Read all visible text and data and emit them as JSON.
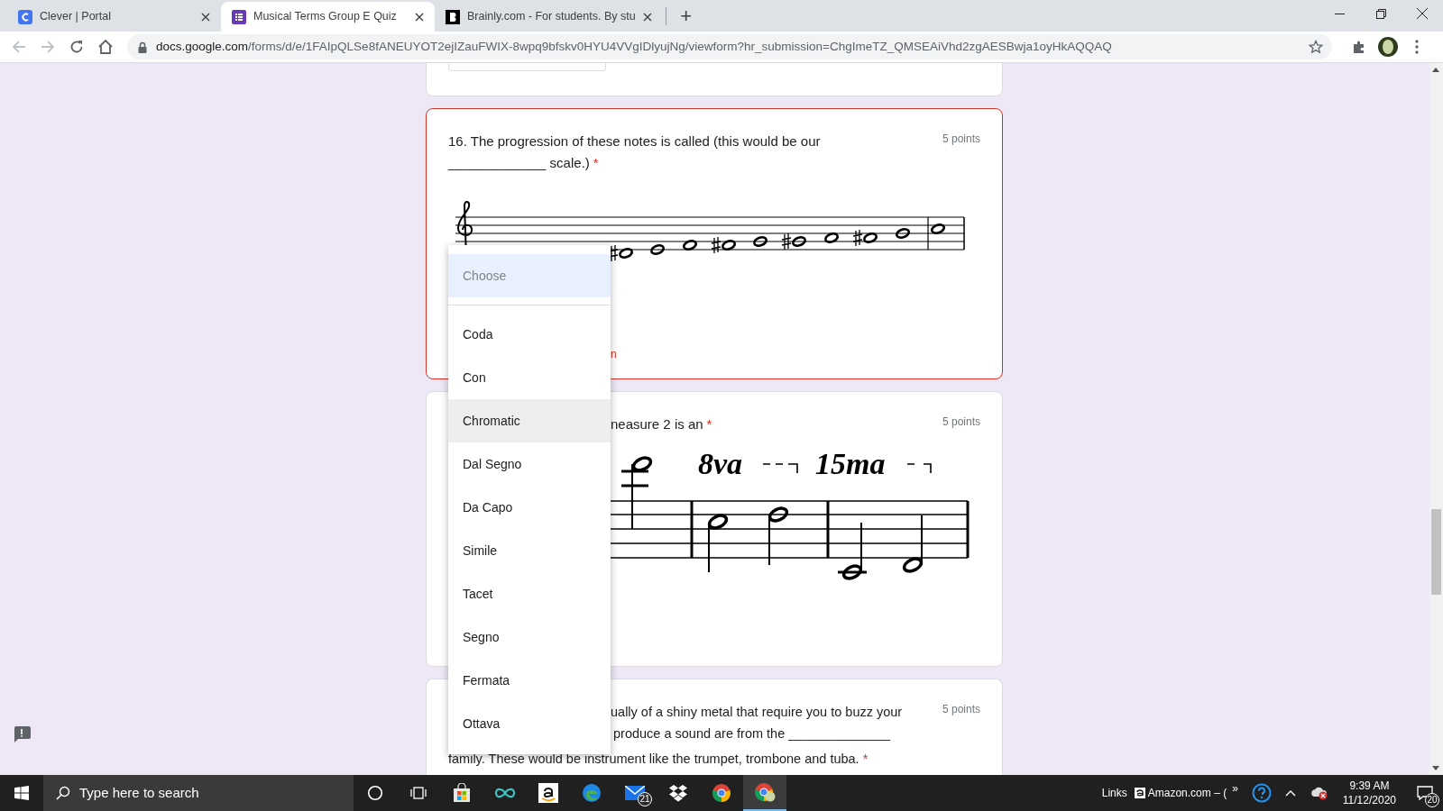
{
  "browser": {
    "tabs": [
      {
        "title": "Clever | Portal",
        "selected": false,
        "kind": "clever"
      },
      {
        "title": "Musical Terms Group E Quiz",
        "selected": true,
        "kind": "forms"
      },
      {
        "title": "Brainly.com - For students. By stu",
        "selected": false,
        "kind": "brainly"
      }
    ],
    "new_tab": "+",
    "url_host": "docs.google.com",
    "url_path": "/forms/d/e/1FAIpQLSe8fANEUYOT2ejIZauFWIX-8wpq9bfskv0HYU4VVgIDlyujNg/viewform?hr_submission=ChgImeTZ_QMSEAiVhd2zgAESBwja1oyHkAQQAQ"
  },
  "questions": [
    {
      "kind": "scale",
      "invalid": true,
      "required_mark": "*",
      "points": "5 points",
      "lines": [
        "16. The progression of these notes is called (this would be our",
        "_____________ scale.)"
      ],
      "error_fragment": "n"
    },
    {
      "kind": "octave",
      "invalid": false,
      "required_mark": "*",
      "points": "5 points",
      "lines": [
        "neasure 2 is an"
      ],
      "notation_labels": [
        "8va",
        "15ma"
      ]
    },
    {
      "kind": "text",
      "invalid": false,
      "required_mark": "*",
      "points": "5 points",
      "lines": [
        "ually of a shiny metal that require you to buzz your",
        "produce a sound are from the ______________",
        "family. These would be instrument like the trumpet, trombone and tuba."
      ]
    }
  ],
  "dropdown": {
    "placeholder": "Choose",
    "placeholder_highlighted": true,
    "options": [
      {
        "label": "Coda",
        "highlighted": false
      },
      {
        "label": "Con",
        "highlighted": false
      },
      {
        "label": "Chromatic",
        "highlighted": true
      },
      {
        "label": "Dal Segno",
        "highlighted": false
      },
      {
        "label": "Da Capo",
        "highlighted": false
      },
      {
        "label": "Simile",
        "highlighted": false
      },
      {
        "label": "Tacet",
        "highlighted": false
      },
      {
        "label": "Segno",
        "highlighted": false
      },
      {
        "label": "Fermata",
        "highlighted": false
      },
      {
        "label": "Ottava",
        "highlighted": false
      }
    ]
  },
  "taskbar": {
    "search_placeholder": "Type here to search",
    "pinned": [
      {
        "kind": "cortana",
        "active": false
      },
      {
        "kind": "taskview",
        "active": false
      },
      {
        "kind": "store",
        "active": false
      },
      {
        "kind": "infinity",
        "active": false
      },
      {
        "kind": "amazon",
        "active": false
      },
      {
        "kind": "edge",
        "active": false
      },
      {
        "kind": "mail",
        "active": false,
        "badge": "21"
      },
      {
        "kind": "dropbox",
        "active": false
      },
      {
        "kind": "chrome",
        "active": false
      },
      {
        "kind": "chrome-profile",
        "active": true
      }
    ],
    "links_label": "Links",
    "amazon_link": "Amazon.com – (",
    "overflow": "»",
    "time": "9:39 AM",
    "date": "11/12/2020",
    "notifications": "20"
  }
}
